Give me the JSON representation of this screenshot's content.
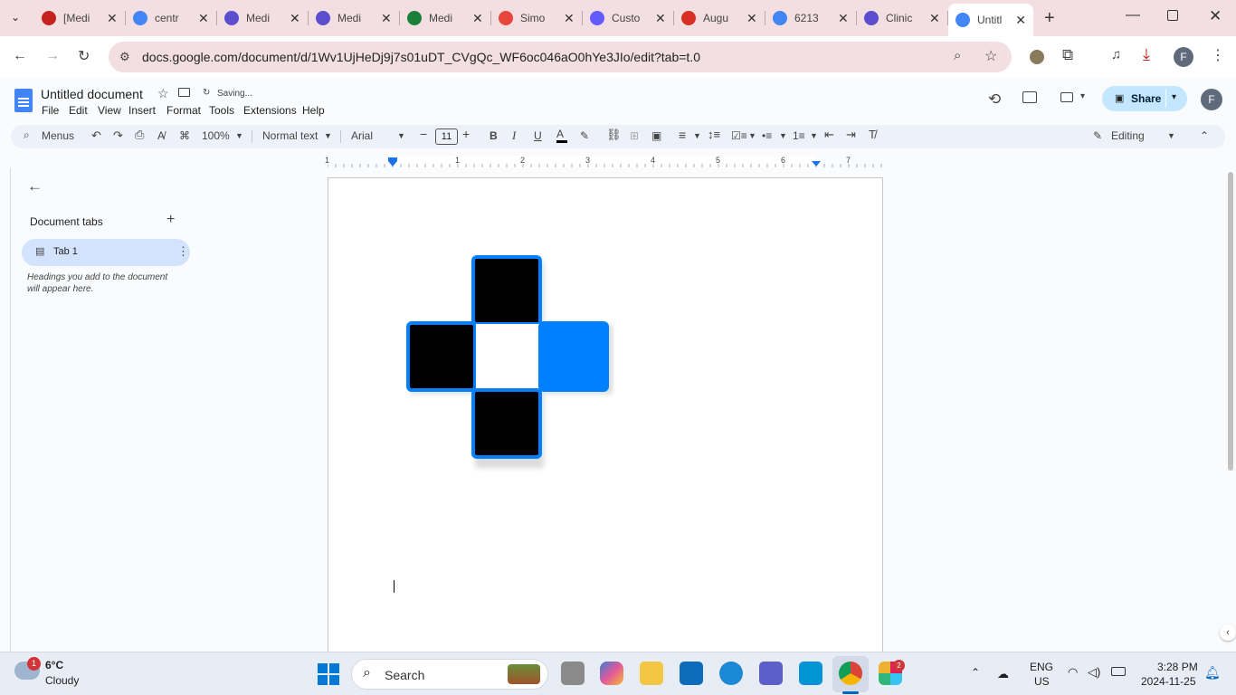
{
  "browser": {
    "tabs": [
      {
        "title": "[Medi",
        "icon": "gmail-icon",
        "color": "#c5221f"
      },
      {
        "title": "centr",
        "icon": "google-icon",
        "color": "#4285f4"
      },
      {
        "title": "Medi",
        "icon": "m-icon",
        "color": "#5b4fcf"
      },
      {
        "title": "Medi",
        "icon": "m-icon",
        "color": "#5b4fcf"
      },
      {
        "title": "Medi",
        "icon": "sheets-icon",
        "color": "#188038"
      },
      {
        "title": "Simo",
        "icon": "simon-icon",
        "color": "#e8453c"
      },
      {
        "title": "Custo",
        "icon": "s-icon",
        "color": "#635bff"
      },
      {
        "title": "Augu",
        "icon": "alert-icon",
        "color": "#d93025"
      },
      {
        "title": "6213",
        "icon": "google-icon",
        "color": "#4285f4"
      },
      {
        "title": "Clinic",
        "icon": "m-icon",
        "color": "#5b4fcf"
      },
      {
        "title": "Untitl",
        "icon": "docs-icon",
        "color": "#4285f4"
      }
    ],
    "url": "docs.google.com/document/d/1Wv1UjHeDj9j7s01uDT_CVgQc_WF6oc046aO0hYe3JIo/edit?tab=t.0",
    "profile_letter": "F"
  },
  "doc": {
    "title": "Untitled document",
    "status": "Saving...",
    "menus": [
      "File",
      "Edit",
      "View",
      "Insert",
      "Format",
      "Tools",
      "Extensions",
      "Help"
    ],
    "share_label": "Share",
    "profile_letter": "F"
  },
  "toolbar": {
    "search_label": "Menus",
    "zoom": "100%",
    "style": "Normal text",
    "font": "Arial",
    "font_size": "11",
    "mode": "Editing"
  },
  "ruler": {
    "numbers": [
      "1",
      "1",
      "2",
      "3",
      "4",
      "5",
      "6",
      "7"
    ]
  },
  "sidebar": {
    "heading": "Document tabs",
    "tab_label": "Tab 1",
    "hint": "Headings you add to the document will appear here."
  },
  "taskbar": {
    "weather_temp": "6°C",
    "weather_desc": "Cloudy",
    "weather_badge": "1",
    "search_label": "Search",
    "lang_top": "ENG",
    "lang_bottom": "US",
    "time": "3:28 PM",
    "date": "2024-11-25",
    "slack_badge": "2"
  },
  "colors": {
    "accent": "#0b57d0",
    "share_bg": "#c2e7ff",
    "tab_strip": "#f3dfe2",
    "shape_blue": "#0080ff"
  }
}
